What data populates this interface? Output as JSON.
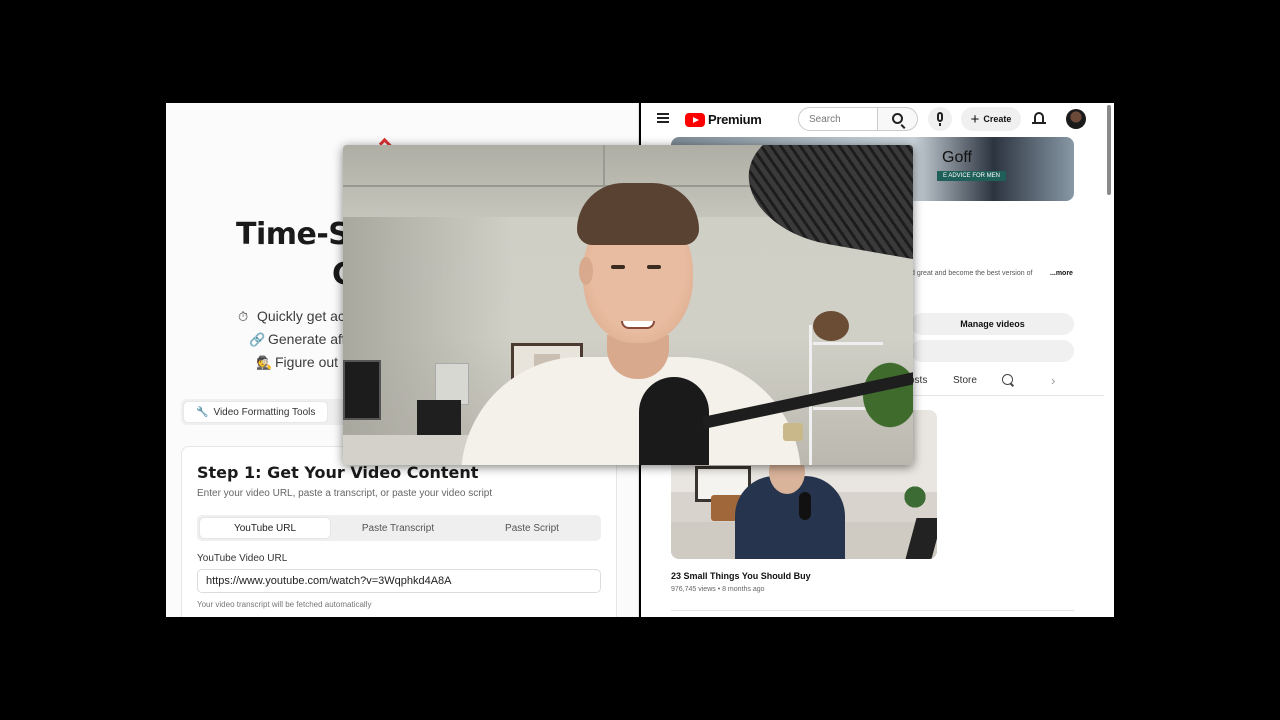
{
  "left_app": {
    "hero": {
      "title_line1": "Time-S",
      "title_line2": "C"
    },
    "features": [
      {
        "icon": "⏱",
        "text": "Quickly get ac"
      },
      {
        "icon": "🔗",
        "text": "Generate aff"
      },
      {
        "icon": "🕵",
        "text": "Figure out"
      }
    ],
    "format_tabs": {
      "active_label": "Video Formatting Tools",
      "active_icon": "wrench-icon"
    },
    "step": {
      "title": "Step 1: Get Your Video Content",
      "subtitle": "Enter your video URL, paste a transcript, or paste your video script",
      "tabs": [
        {
          "label": "YouTube URL",
          "active": true
        },
        {
          "label": "Paste Transcript",
          "active": false
        },
        {
          "label": "Paste Script",
          "active": false
        }
      ],
      "url_label": "YouTube Video URL",
      "url_value": "https://www.youtube.com/watch?v=3Wqphkd4A8A",
      "url_hint": "Your video transcript will be fetched automatically"
    }
  },
  "youtube": {
    "logo_text": "Premium",
    "search_placeholder": "Search",
    "create_label": "Create",
    "banner": {
      "name": "Goff",
      "tagline": "E ADVICE FOR MEN"
    },
    "channel_description": "d great and become the best version of",
    "more_label": "...more",
    "manage_videos_label": "Manage videos",
    "tabs": [
      {
        "label": "osts"
      },
      {
        "label": "Store"
      }
    ],
    "video": {
      "title": "23 Small Things You Should Buy",
      "meta": "976,745 views • 8 months ago"
    }
  },
  "colors": {
    "youtube_red": "#ff0000",
    "banner_tag_bg": "#1f5f5a",
    "page_bg": "#000000"
  }
}
